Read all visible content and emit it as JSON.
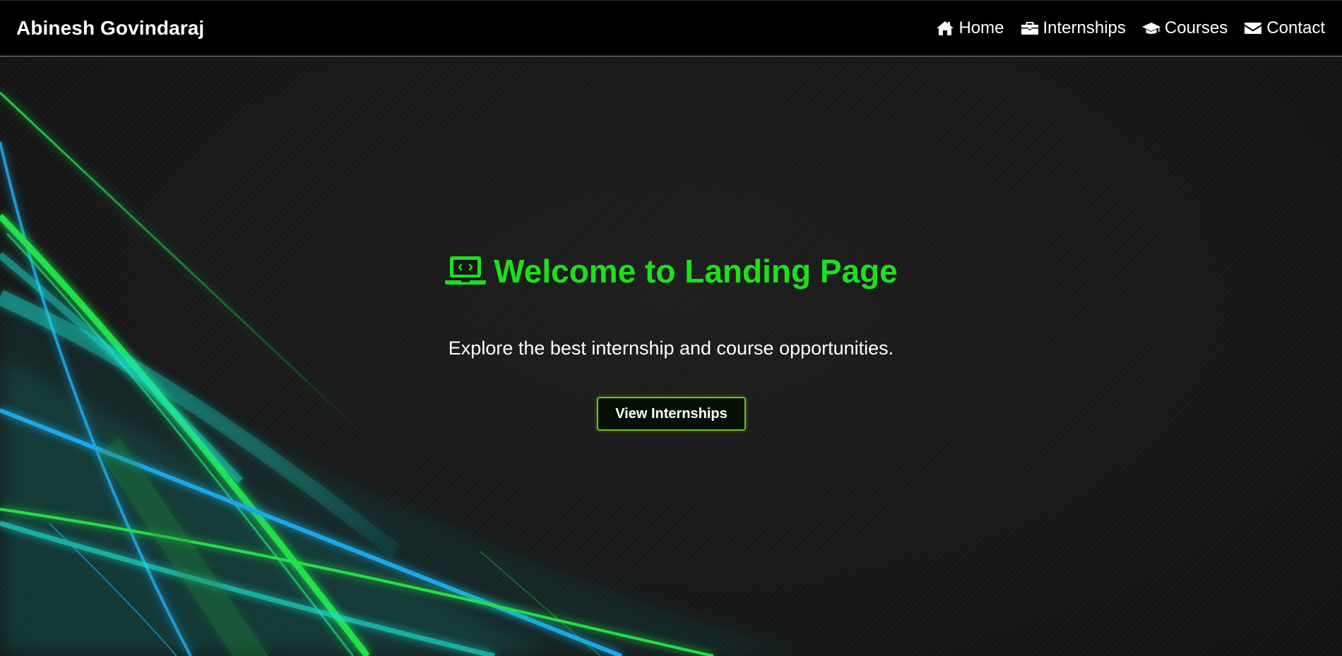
{
  "header": {
    "brand": "Abinesh Govindaraj",
    "nav": [
      {
        "label": "Home",
        "icon": "home-icon"
      },
      {
        "label": "Internships",
        "icon": "briefcase-icon"
      },
      {
        "label": "Courses",
        "icon": "graduation-cap-icon"
      },
      {
        "label": "Contact",
        "icon": "envelope-icon"
      }
    ]
  },
  "hero": {
    "title": "Welcome to Landing Page",
    "title_icon": "laptop-code-icon",
    "subtitle": "Explore the best internship and course opportunities.",
    "cta_label": "View Internships"
  },
  "colors": {
    "accent_green": "#1de01d",
    "nav_background": "#000000",
    "hero_background": "#171717",
    "button_border": "#6fc21a",
    "streak_green": "#22e04a",
    "streak_cyan": "#1ae0d0",
    "streak_blue": "#1aa8e8"
  }
}
